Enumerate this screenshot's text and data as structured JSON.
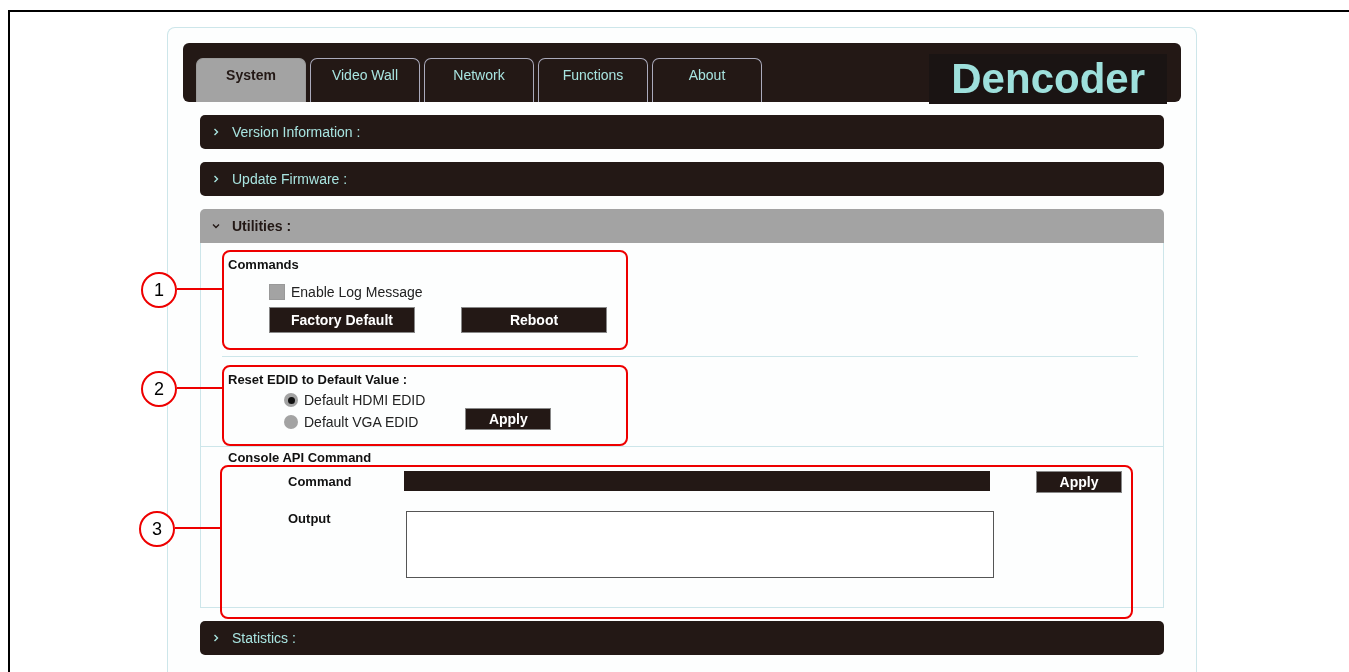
{
  "header": {
    "tabs": [
      {
        "label": "System",
        "selected": true
      },
      {
        "label": "Video Wall",
        "selected": false
      },
      {
        "label": "Network",
        "selected": false
      },
      {
        "label": "Functions",
        "selected": false
      },
      {
        "label": "About",
        "selected": false
      }
    ],
    "logo": "Dencoder"
  },
  "sections": [
    {
      "title": "Version Information :",
      "expanded": false
    },
    {
      "title": "Update Firmware :",
      "expanded": false
    },
    {
      "title": "Utilities :",
      "expanded": true
    },
    {
      "title": "Statistics :",
      "expanded": false
    }
  ],
  "utilities": {
    "commands": {
      "callout": "1",
      "title": "Commands",
      "checkbox": {
        "label": "Enable Log Message",
        "checked": false
      },
      "buttons": [
        "Factory Default",
        "Reboot"
      ]
    },
    "edid": {
      "callout": "2",
      "title": "Reset EDID to Default Value :",
      "options": [
        {
          "label": "Default HDMI EDID",
          "selected": true
        },
        {
          "label": "Default VGA EDID",
          "selected": false
        }
      ],
      "button": "Apply"
    },
    "console": {
      "callout": "3",
      "title": "Console API Command",
      "command_label": "Command",
      "button": "Apply",
      "output_label": "Output"
    }
  }
}
